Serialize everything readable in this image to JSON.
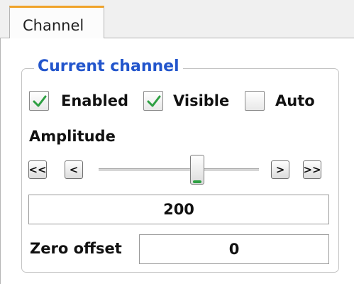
{
  "tab": {
    "label": "Channel"
  },
  "group": {
    "title": "Current channel"
  },
  "checkboxes": [
    {
      "label": "Enabled",
      "checked": true
    },
    {
      "label": "Visible",
      "checked": true
    },
    {
      "label": "Auto",
      "checked": false
    }
  ],
  "amplitude": {
    "label": "Amplitude",
    "value": "200",
    "buttons": {
      "fast_back": "<<",
      "back": "<",
      "forward": ">",
      "fast_forward": ">>"
    },
    "slider_position": 0.6
  },
  "zero_offset": {
    "label": "Zero offset",
    "value": "0"
  },
  "colors": {
    "accent": "#f0a32a",
    "title": "#2255cc",
    "check": "#2ea043"
  }
}
